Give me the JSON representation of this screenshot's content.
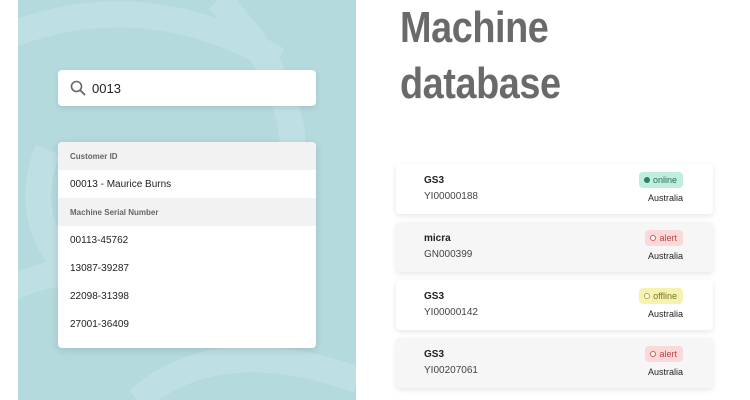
{
  "search": {
    "value": "0013",
    "icon": "search-icon"
  },
  "dropdown": {
    "customer_header": "Customer ID",
    "customers": [
      "00013 - Maurice Burns"
    ],
    "serial_header": "Machine Serial Number",
    "serials": [
      "00113-45762",
      "13087-39287",
      "22098-31398",
      "27001-36409"
    ]
  },
  "page": {
    "title_line1": "Machine",
    "title_line2": "database"
  },
  "machines": [
    {
      "model": "GS3",
      "serial": "YI00000188",
      "status": "online",
      "country": "Australia"
    },
    {
      "model": "micra",
      "serial": "GN000399",
      "status": "alert",
      "country": "Australia"
    },
    {
      "model": "GS3",
      "serial": "YI00000142",
      "status": "offline",
      "country": "Australia"
    },
    {
      "model": "GS3",
      "serial": "YI00207061",
      "status": "alert",
      "country": "Australia"
    }
  ],
  "colors": {
    "panel_bg": "#b4dade",
    "title": "#6a6a6a",
    "online": "#bfeedd",
    "alert": "#fbd9d9",
    "offline": "#f6f3b2"
  }
}
